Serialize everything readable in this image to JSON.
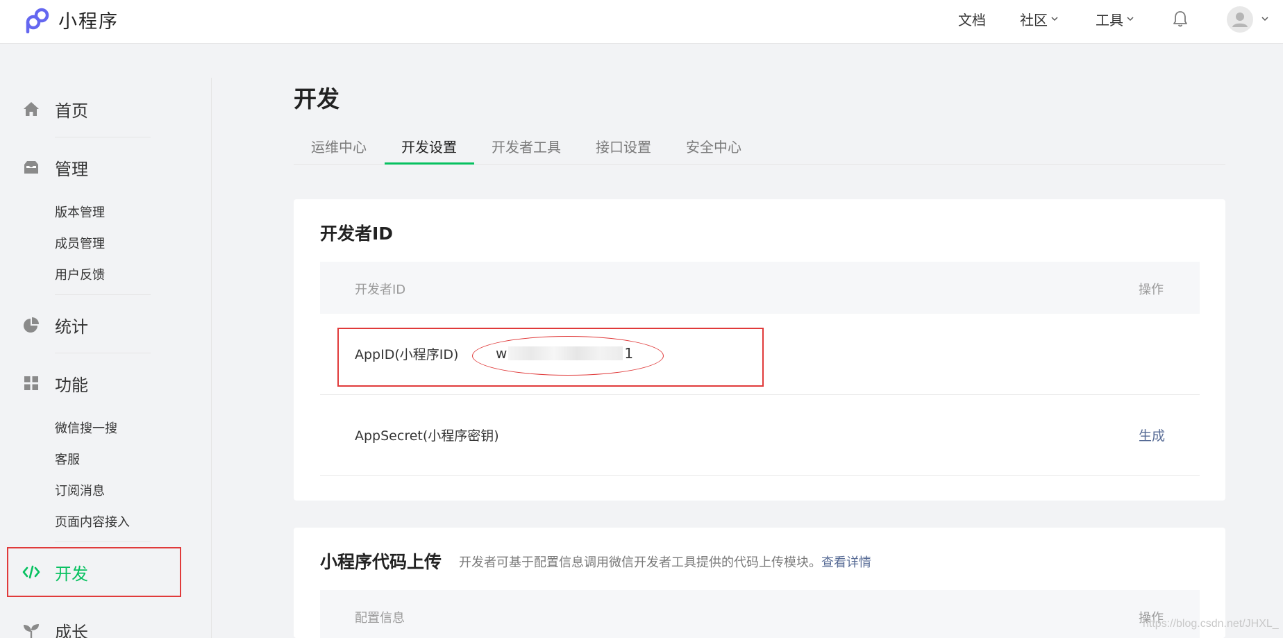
{
  "header": {
    "brand": "小程序",
    "nav": [
      {
        "label": "文档",
        "has_dropdown": false
      },
      {
        "label": "社区",
        "has_dropdown": true
      },
      {
        "label": "工具",
        "has_dropdown": true
      }
    ],
    "icons": [
      "notification-bell-icon",
      "user-avatar-icon"
    ]
  },
  "sidebar": {
    "sections": [
      {
        "label": "首页",
        "icon": "home-icon"
      },
      {
        "label": "管理",
        "icon": "inbox-icon",
        "items": [
          "版本管理",
          "成员管理",
          "用户反馈"
        ]
      },
      {
        "label": "统计",
        "icon": "pie-chart-icon"
      },
      {
        "label": "功能",
        "icon": "grid-icon",
        "items": [
          "微信搜一搜",
          "客服",
          "订阅消息",
          "页面内容接入"
        ]
      },
      {
        "label": "开发",
        "icon": "code-icon",
        "active": true
      },
      {
        "label": "成长",
        "icon": "sprout-icon"
      }
    ]
  },
  "main": {
    "title": "开发",
    "tabs": [
      "运维中心",
      "开发设置",
      "开发者工具",
      "接口设置",
      "安全中心"
    ],
    "active_tab": "开发设置",
    "developer_id_card": {
      "title": "开发者ID",
      "columns": [
        "开发者ID",
        "操作"
      ],
      "rows": [
        {
          "label": "AppID(小程序ID)",
          "value_start": "w",
          "value_end": "1",
          "action": ""
        },
        {
          "label": "AppSecret(小程序密钥)",
          "action": "生成"
        }
      ]
    },
    "upload_card": {
      "title": "小程序代码上传",
      "description": "开发者可基于配置信息调用微信开发者工具提供的代码上传模块。",
      "link": "查看详情",
      "columns": [
        "配置信息",
        "操作"
      ]
    }
  },
  "watermark": "https://blog.csdn.net/JHXL_",
  "colors": {
    "accent_green": "#07c160",
    "link_blue": "#576b95",
    "annotation_red": "#e03a3a"
  }
}
